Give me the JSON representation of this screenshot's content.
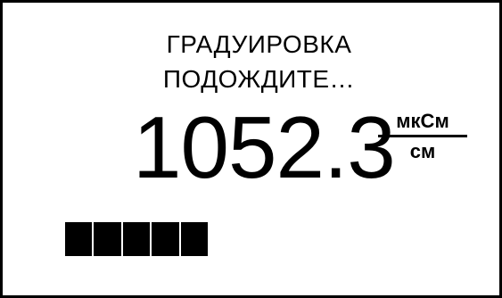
{
  "screen": {
    "title_line1": "ГРАДУИРОВКА",
    "title_line2": "ПОДОЖДИТЕ…",
    "reading": {
      "value": "1052.3",
      "unit_numerator": "мкСм",
      "unit_denominator": "см"
    },
    "progress": {
      "filled_segments": 5
    }
  },
  "colors": {
    "foreground": "#000000",
    "background": "#ffffff"
  }
}
